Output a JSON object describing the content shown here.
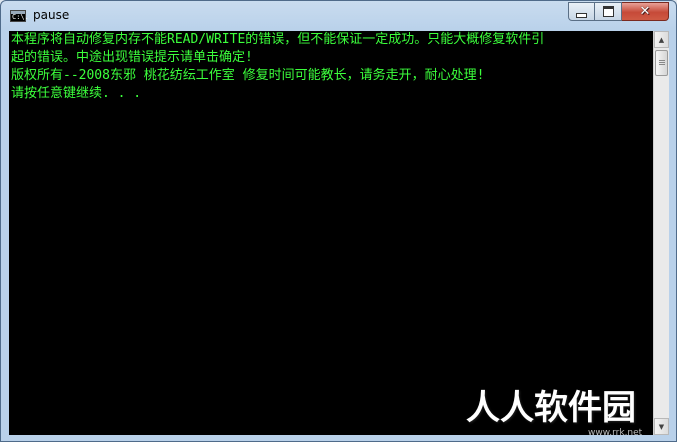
{
  "window": {
    "title": "pause",
    "icon": "console-icon",
    "icon_text": "C:\\.",
    "controls": {
      "minimize": "minimize-icon",
      "maximize": "maximize-icon",
      "close": "close-icon",
      "close_glyph": "✕"
    }
  },
  "console": {
    "text_color": "#3cff3c",
    "background": "#000000",
    "lines": [
      "本程序将自动修复内存不能READ/WRITE的错误，但不能保证一定成功。只能大概修复软件引",
      "起的错误。中途出现错误提示请单击确定!",
      "版权所有--2008东邪 桃花纺纭工作室 修复时间可能教长，请务走开，耐心处理!",
      "请按任意键继续. . ."
    ]
  },
  "scrollbar": {
    "up_arrow": "▲",
    "down_arrow": "▼"
  },
  "watermark": {
    "text": "人人软件园",
    "url": "www.rrk.net"
  }
}
